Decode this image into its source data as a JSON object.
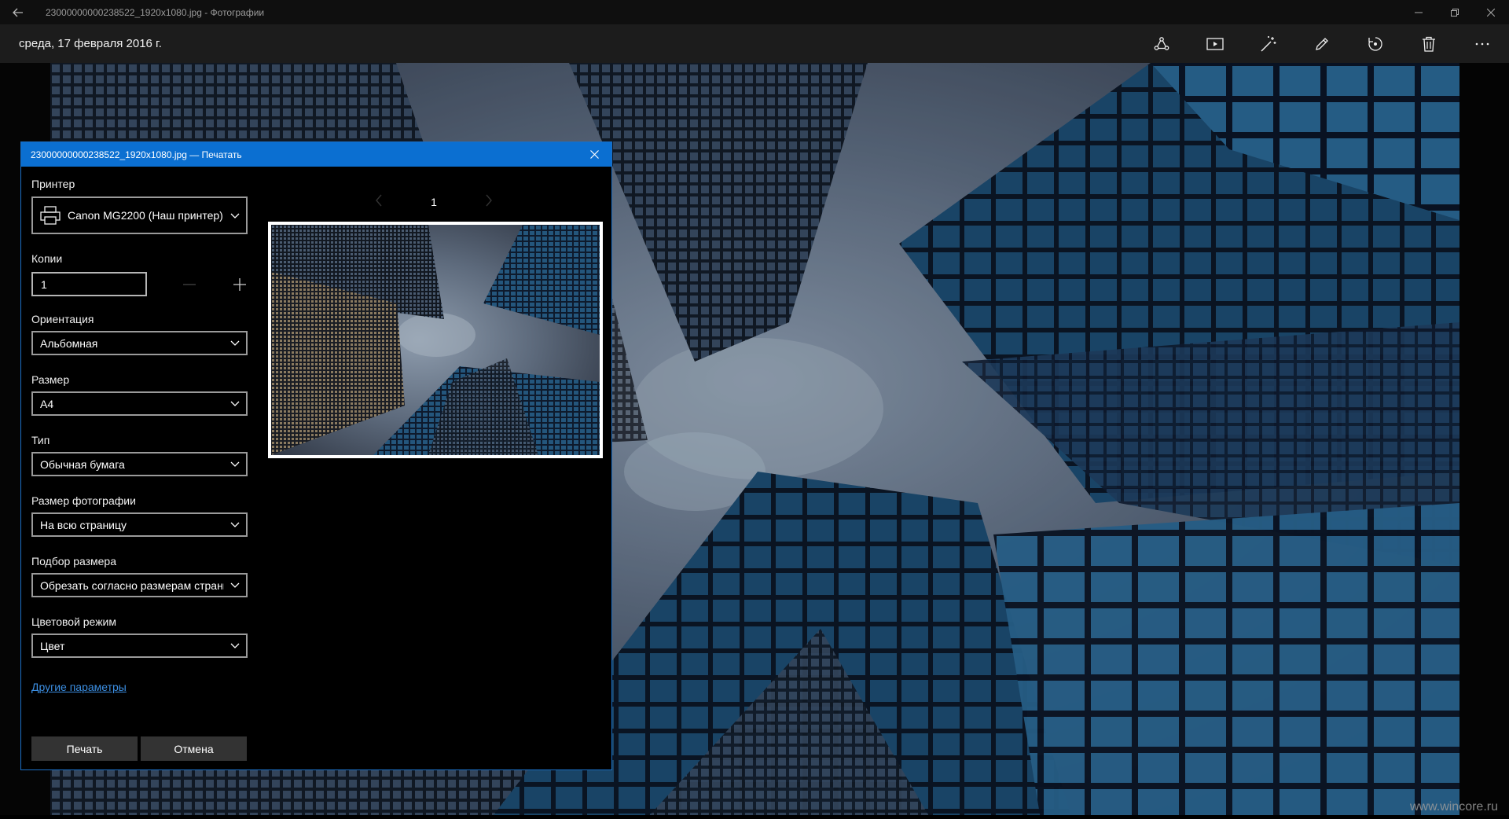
{
  "window": {
    "title": "23000000000238522_1920x1080.jpg - Фотографии"
  },
  "command_bar": {
    "date": "среда, 17 февраля 2016 г.",
    "icons": [
      "share-icon",
      "slideshow-icon",
      "enhance-icon",
      "edit-icon",
      "rotate-icon",
      "delete-icon",
      "more-icon"
    ]
  },
  "watermark": "www.wincore.ru",
  "dialog": {
    "title": "23000000000238522_1920x1080.jpg — Печатать",
    "printer": {
      "label": "Принтер",
      "value": "Canon MG2200 (Наш принтер)"
    },
    "copies": {
      "label": "Копии",
      "value": "1"
    },
    "orientation": {
      "label": "Ориентация",
      "value": "Альбомная"
    },
    "size": {
      "label": "Размер",
      "value": "A4"
    },
    "type": {
      "label": "Тип",
      "value": "Обычная бумага"
    },
    "photo_size": {
      "label": "Размер фотографии",
      "value": "На всю страницу"
    },
    "fit": {
      "label": "Подбор размера",
      "value": "Обрезать согласно размерам страницы"
    },
    "color_mode": {
      "label": "Цветовой режим",
      "value": "Цвет"
    },
    "more_settings": "Другие параметры",
    "print_button": "Печать",
    "cancel_button": "Отмена",
    "preview": {
      "page_number": "1"
    }
  },
  "colors": {
    "accent": "#0b6fd1",
    "link": "#3c8fe3",
    "button": "#333333"
  }
}
